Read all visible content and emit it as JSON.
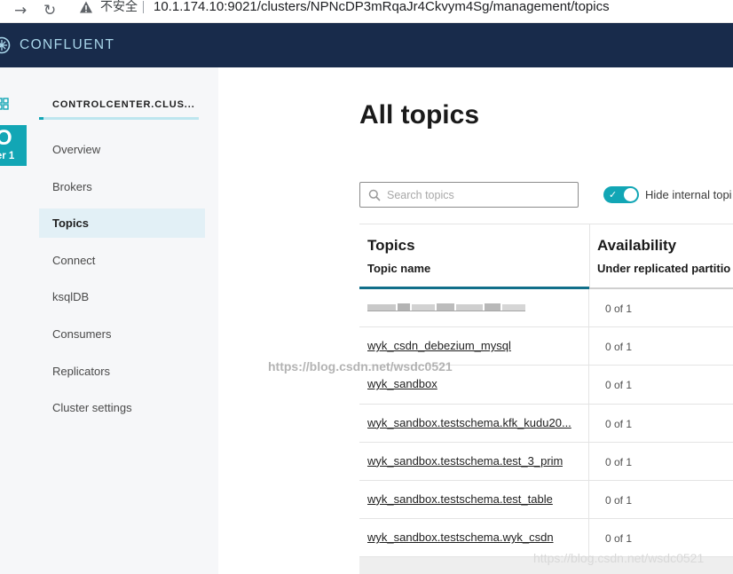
{
  "browser": {
    "security_label": "不安全",
    "url": "10.1.174.10:9021/clusters/NPNcDP3mRqaJr4Ckvym4Sg/management/topics"
  },
  "header": {
    "brand": "CONFLUENT"
  },
  "cluster_badge": {
    "letter": "O",
    "name": "ter 1"
  },
  "sidebar": {
    "cluster_title": "CONTROLCENTER.CLUS...",
    "items": [
      {
        "label": "Overview",
        "active": false
      },
      {
        "label": "Brokers",
        "active": false
      },
      {
        "label": "Topics",
        "active": true
      },
      {
        "label": "Connect",
        "active": false
      },
      {
        "label": "ksqlDB",
        "active": false
      },
      {
        "label": "Consumers",
        "active": false
      },
      {
        "label": "Replicators",
        "active": false
      },
      {
        "label": "Cluster settings",
        "active": false
      }
    ]
  },
  "main": {
    "title": "All topics",
    "search": {
      "placeholder": "Search topics",
      "value": ""
    },
    "toggle": {
      "label": "Hide internal topi",
      "checked": true
    }
  },
  "table": {
    "group_headers": [
      "Topics",
      "Availability"
    ],
    "column_headers": [
      "Topic name",
      "Under replicated partitio"
    ],
    "rows": [
      {
        "name": "",
        "redacted": true,
        "availability": "0 of 1"
      },
      {
        "name": "wyk_csdn_debezium_mysql",
        "redacted": false,
        "availability": "0 of 1"
      },
      {
        "name": "wyk_sandbox",
        "redacted": false,
        "availability": "0 of 1"
      },
      {
        "name": "wyk_sandbox.testschema.kfk_kudu20...",
        "redacted": false,
        "availability": "0 of 1"
      },
      {
        "name": "wyk_sandbox.testschema.test_3_prim",
        "redacted": false,
        "availability": "0 of 1"
      },
      {
        "name": "wyk_sandbox.testschema.test_table",
        "redacted": false,
        "availability": "0 of 1"
      },
      {
        "name": "wyk_sandbox.testschema.wyk_csdn",
        "redacted": false,
        "availability": "0 of 1"
      }
    ]
  },
  "watermarks": {
    "center": "https://blog.csdn.net/wsdc0521",
    "corner": "https://blog.csdn.net/wsdc0521"
  },
  "colors": {
    "header_bg": "#182b4b",
    "brand_text": "#a9d6ea",
    "accent": "#12a6b5",
    "sidebar_bg": "#f6f7f9",
    "active_nav_bg": "#e2f0f6",
    "table_header_underline": "#116f8a"
  },
  "icons": {
    "forward": "arrow-right-icon",
    "reload": "reload-icon",
    "security": "warning-triangle-icon",
    "logo": "confluent-logo-icon",
    "grid": "grid-icon",
    "search": "search-icon",
    "toggle_check": "check-icon"
  }
}
